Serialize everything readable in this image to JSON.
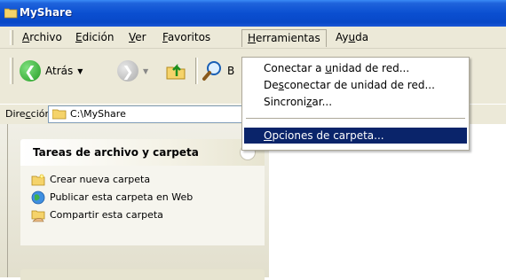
{
  "window": {
    "title": "MyShare"
  },
  "menubar": {
    "items": [
      {
        "label": "Archivo"
      },
      {
        "label": "Edición"
      },
      {
        "label": "Ver"
      },
      {
        "label": "Favoritos"
      },
      {
        "label": "Herramientas"
      },
      {
        "label": "Ayuda"
      }
    ]
  },
  "toolbar": {
    "back_label": "Atrás",
    "search_initial": "B"
  },
  "address": {
    "label": "Dirección",
    "value": "C:\\MyShare"
  },
  "tools_menu": {
    "items": [
      {
        "label": "Conectar a unidad de red..."
      },
      {
        "label": "Desconectar de unidad de red..."
      },
      {
        "label": "Sincronizar..."
      },
      {
        "label": "Opciones de carpeta..."
      }
    ],
    "selected": "Opciones de carpeta..."
  },
  "task_pane": {
    "title": "Tareas de archivo y carpeta",
    "tasks": [
      {
        "label": "Crear nueva carpeta",
        "icon": "new-folder-icon"
      },
      {
        "label": "Publicar esta carpeta en Web",
        "icon": "globe-icon"
      },
      {
        "label": "Compartir esta carpeta",
        "icon": "share-folder-icon"
      }
    ]
  },
  "colors": {
    "titlebar": "#0a4fd1",
    "menu_selected": "#0a246a",
    "chrome": "#ece9d8"
  }
}
